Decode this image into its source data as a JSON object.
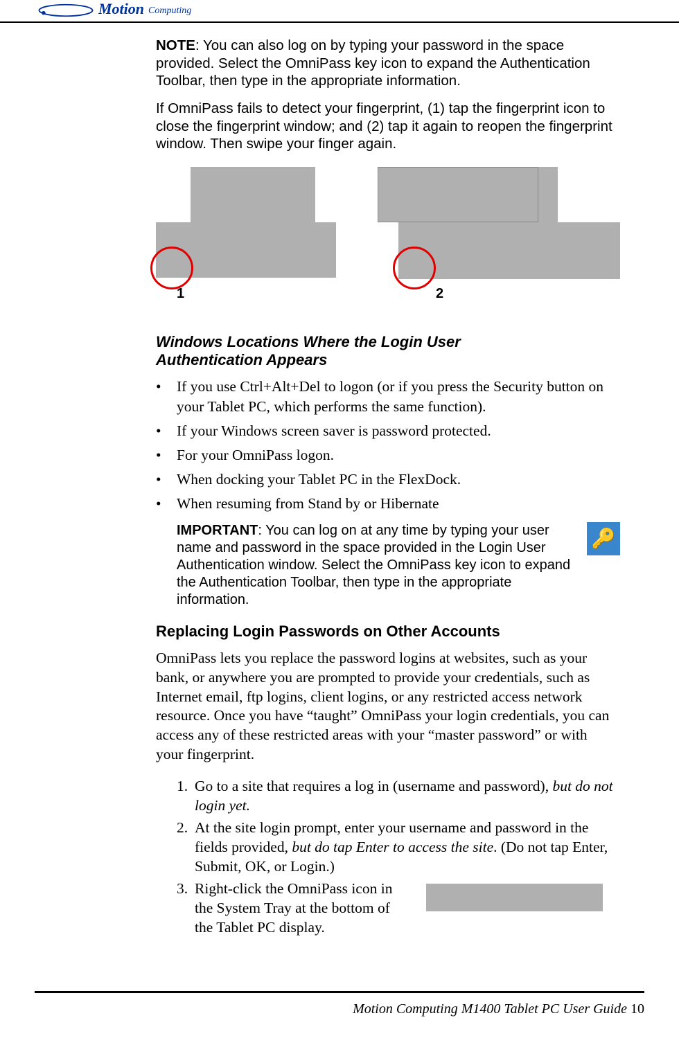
{
  "logo": {
    "brand": "Motion",
    "sub": "Computing"
  },
  "note": {
    "label": "NOTE",
    "text": ": You can also log on by typing your password in the space provided. Select the OmniPass key icon to expand the Authentication Toolbar, then type in the appropriate information."
  },
  "note2": "If OmniPass fails to detect your fingerprint, (1) tap the fingerprint icon to close the fingerprint window; and (2) tap it again to reopen the fingerprint window. Then swipe your finger again.",
  "diagram": {
    "step1": "1",
    "step2": "2"
  },
  "heading_locations_l1": "Windows Locations Where the Login User",
  "heading_locations_l2": "Authentication Appears",
  "bullets": [
    "If you use Ctrl+Alt+Del to logon (or if you press the Security button on your Tablet PC, which performs the same function).",
    "If your Windows screen saver is password protected.",
    "For your OmniPass logon.",
    "When docking your Tablet PC in the FlexDock.",
    "When resuming from Stand by or Hibernate"
  ],
  "important": {
    "label": "IMPORTANT",
    "text": ": You can log on at any time by typing your user name and password in the space provided in the Login User Authentication window. Select the OmniPass key icon to expand the Authentication Toolbar, then type in the appropriate information.",
    "icon": "🔑"
  },
  "heading_replacing": "Replacing Login Passwords on Other Accounts",
  "replacing_para": "OmniPass lets you replace the password logins at websites, such as your bank, or anywhere you are prompted to provide your credentials, such as Internet email, ftp logins, client logins, or any restricted access network resource. Once you have “taught” OmniPass your login credentials, you can access any of these restricted areas with your “master password” or with your fingerprint.",
  "steps": {
    "s1_pre": "Go to a site that requires a log in (username and password), ",
    "s1_italic": "but do not login yet.",
    "s2_pre": "At the site login prompt, enter your username and password in the fields provided, ",
    "s2_italic": "but do tap Enter to access the site",
    "s2_post": ". (Do not tap Enter, Submit, OK, or Login.)",
    "s3": "Right-click the OmniPass icon in the System Tray at the bottom of the Tablet PC display."
  },
  "footer": {
    "text": "Motion Computing M1400 Tablet PC User Guide ",
    "page": "10"
  }
}
